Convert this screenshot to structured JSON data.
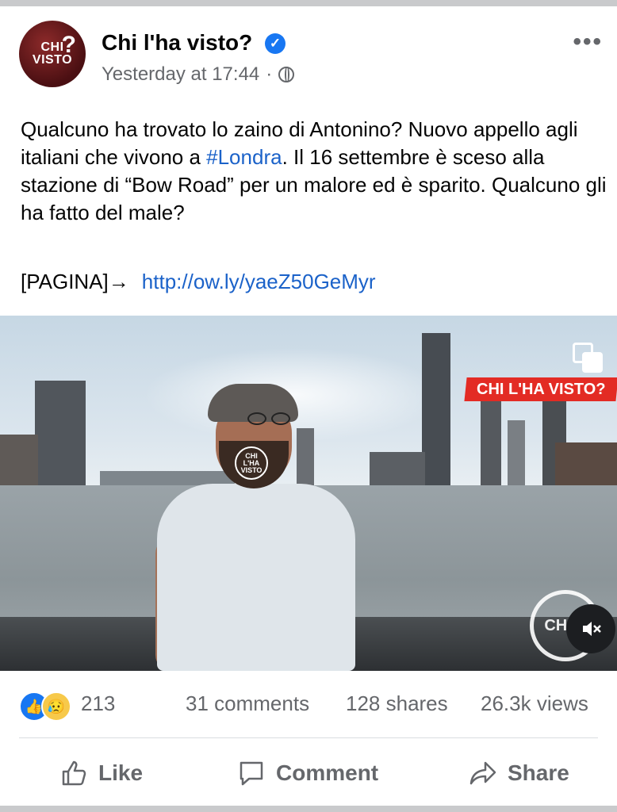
{
  "post": {
    "page_name": "Chi l'ha visto?",
    "avatar_text_line1": "CHI",
    "avatar_text_line2": "VISTO",
    "avatar_q": "?",
    "time": "Yesterday at 17:44",
    "separator": "·",
    "more": "•••",
    "text_before_hashtag": "Qualcuno ha trovato lo zaino di Antonino? Nuovo appello agli italiani che vivono a ",
    "hashtag": "#Londra",
    "text_after_hashtag": ". Il 16 settembre è sceso alla stazione di “Bow Road” per un malore ed è sparito. Qualcuno gli ha fatto del male?",
    "page_prefix": "[PAGINA]→",
    "link": "http://ow.ly/yaeZ50GeMyr"
  },
  "media": {
    "banner_text": "CHI L'HA VISTO?",
    "watermark_small": "CHI L'HA VISTO",
    "watermark_corner": "CHI V"
  },
  "stats": {
    "reactions_count": "213",
    "comments": "31 comments",
    "shares": "128 shares",
    "views": "26.3k views"
  },
  "actions": {
    "like": "Like",
    "comment": "Comment",
    "share": "Share"
  },
  "colors": {
    "link": "#1b62c9",
    "verified": "#1877f2",
    "banner": "#e32b24"
  }
}
